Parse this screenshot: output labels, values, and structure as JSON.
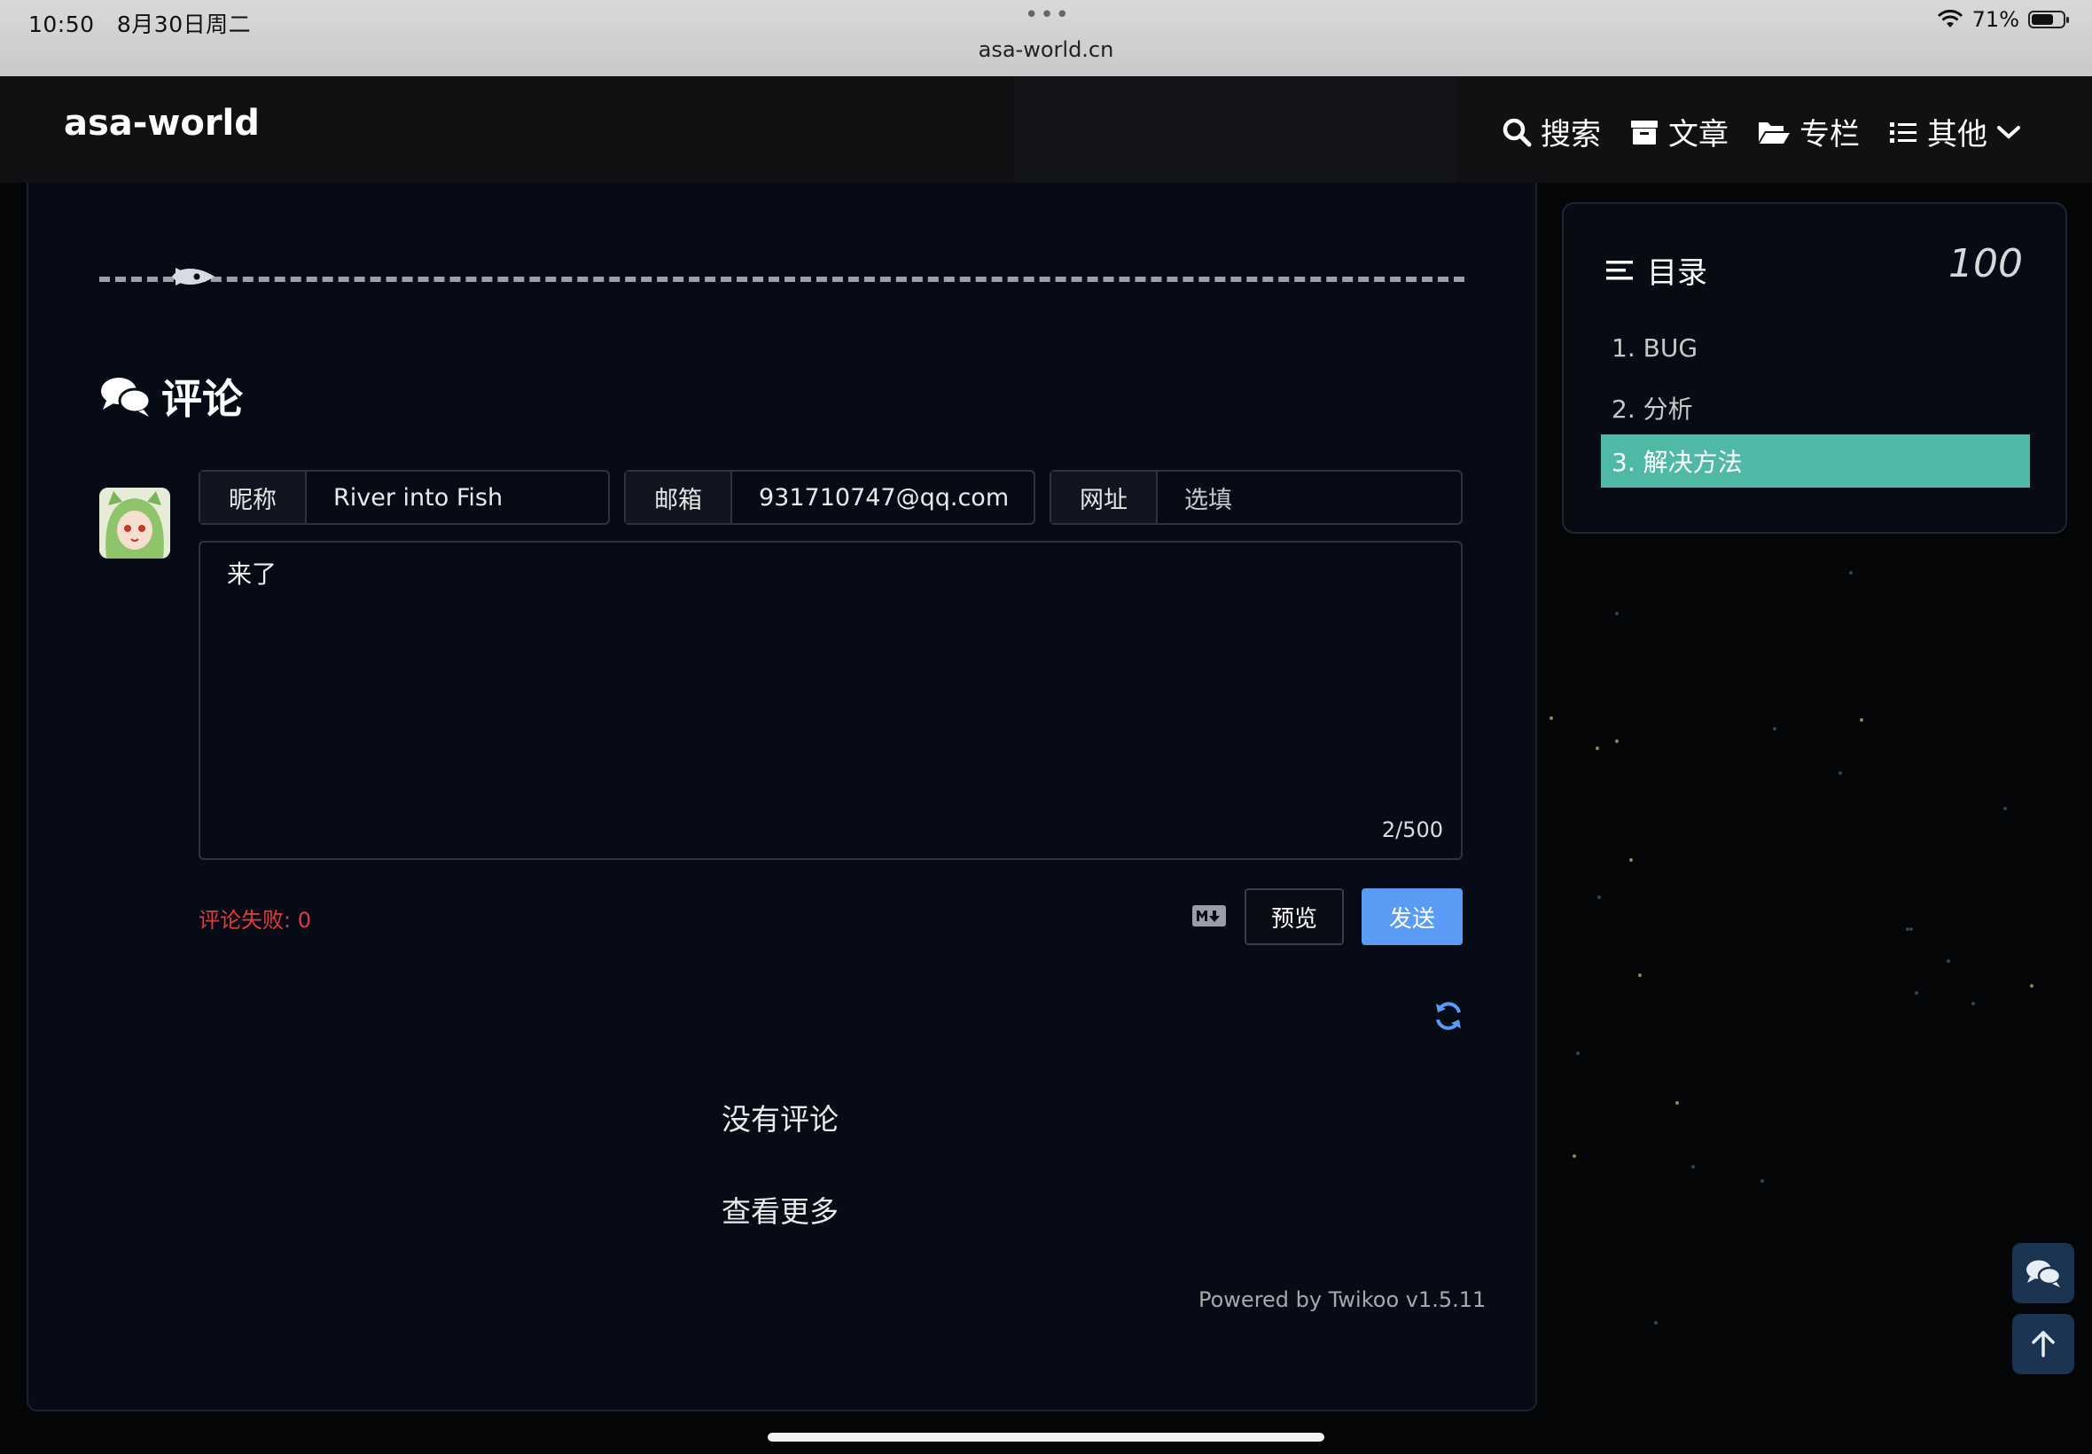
{
  "status_bar": {
    "time": "10:50",
    "date": "8月30日周二",
    "url": "asa-world.cn",
    "battery": "71%",
    "battery_fraction": 0.71,
    "dots": "•••"
  },
  "header": {
    "site_title": "asa-world",
    "nav": [
      {
        "label": "搜索",
        "icon": "search-icon"
      },
      {
        "label": "文章",
        "icon": "archive-icon"
      },
      {
        "label": "专栏",
        "icon": "folder-open-icon"
      },
      {
        "label": "其他",
        "icon": "list-icon"
      }
    ]
  },
  "comments": {
    "heading": "评论",
    "fields": [
      {
        "label": "昵称",
        "value": "River into Fish"
      },
      {
        "label": "邮箱",
        "value": "931710747@qq.com"
      },
      {
        "label": "网址",
        "placeholder": "选填"
      }
    ],
    "content": "来了",
    "counter": "2/500",
    "error": "评论失败: 0",
    "preview_label": "预览",
    "send_label": "发送",
    "no_comments": "没有评论",
    "see_more": "查看更多",
    "powered_by": "Powered by Twikoo v1.5.11"
  },
  "toc": {
    "title": "目录",
    "progress": "100",
    "items": [
      {
        "label": "1. BUG",
        "active": false
      },
      {
        "label": "2. 分析",
        "active": false
      },
      {
        "label": "3. 解决方法",
        "active": true
      }
    ]
  },
  "colors": {
    "accent": "#5a9cf5",
    "toc_active": "#4fb9a6",
    "error": "#e23b3b",
    "background": "#070b16"
  }
}
